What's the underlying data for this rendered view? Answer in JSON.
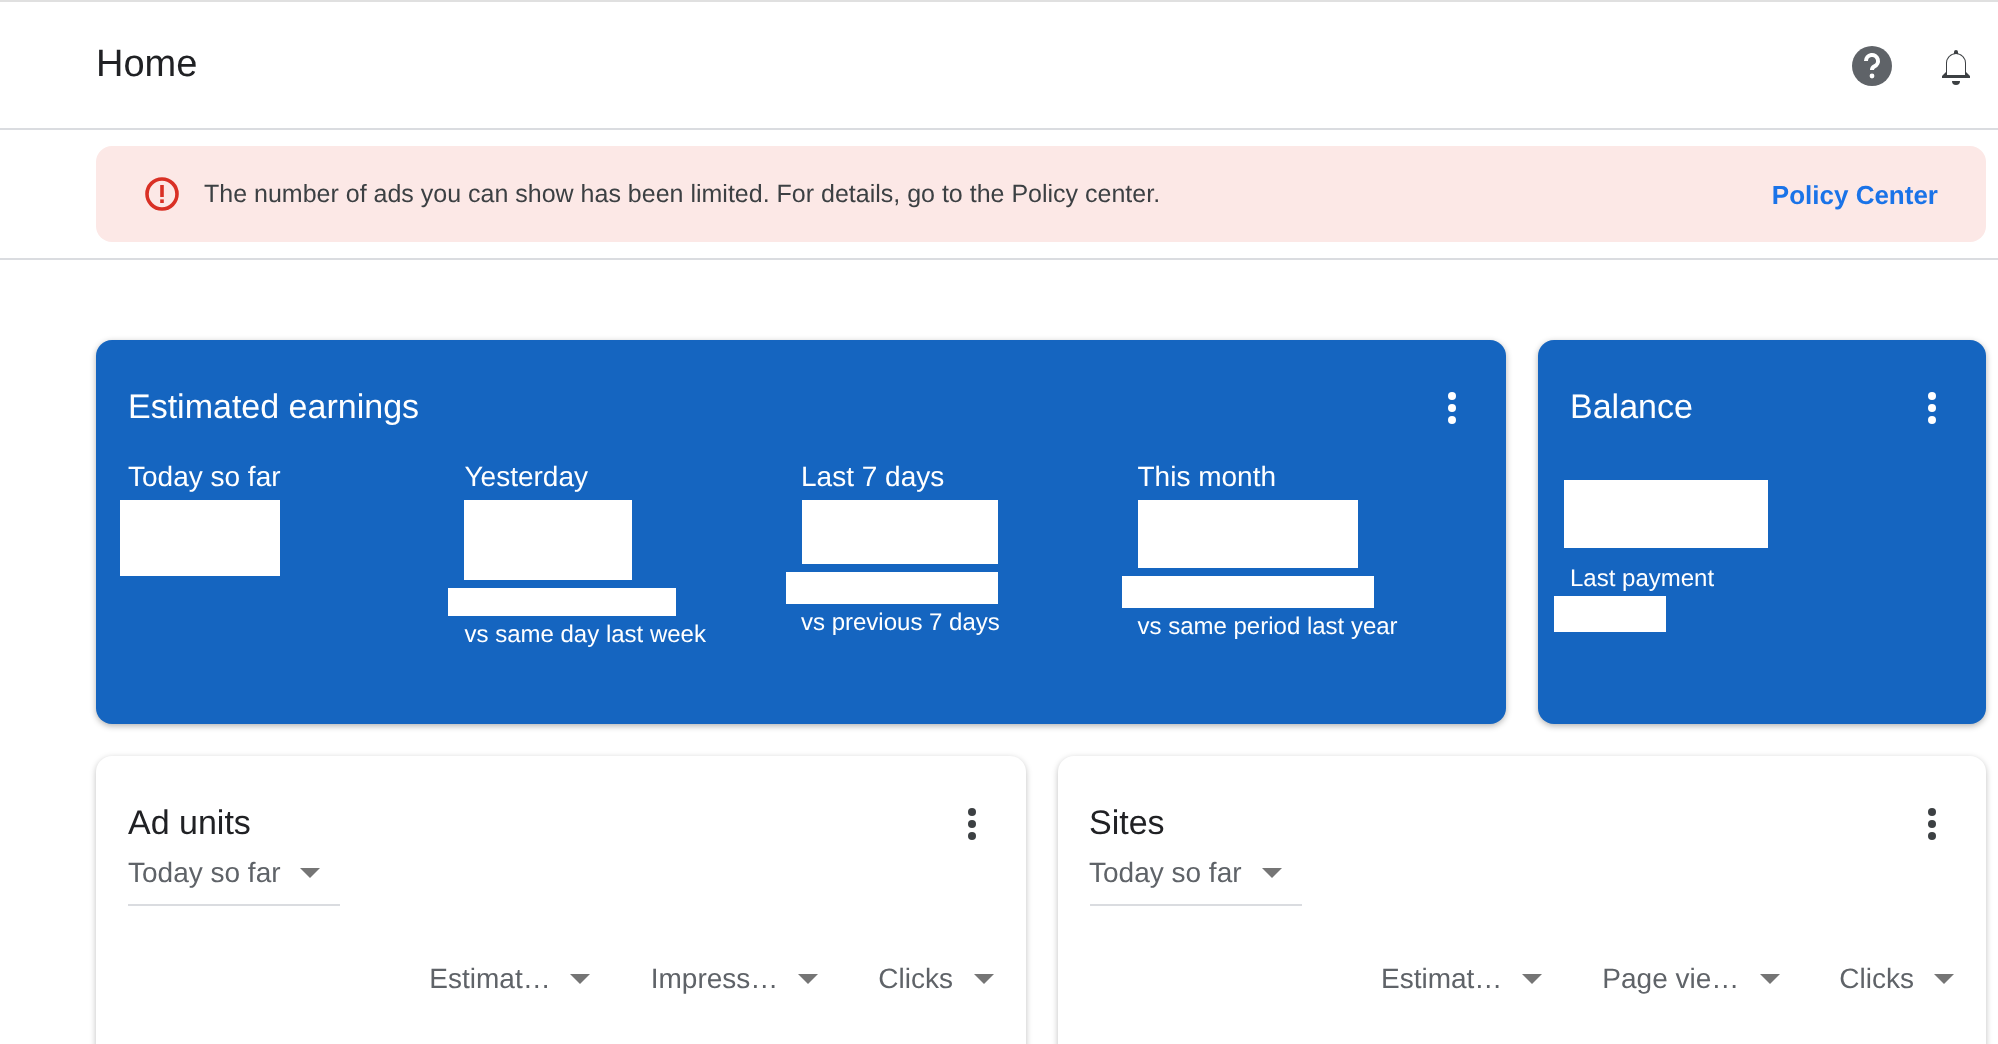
{
  "header": {
    "title": "Home"
  },
  "alert": {
    "message": "The number of ads you can show has been limited. For details, go to the Policy center.",
    "link": "Policy Center"
  },
  "earnings": {
    "title": "Estimated earnings",
    "metrics": [
      {
        "label": "Today so far"
      },
      {
        "label": "Yesterday",
        "comparison": "vs same day last week"
      },
      {
        "label": "Last 7 days",
        "comparison": "vs previous 7 days"
      },
      {
        "label": "This month",
        "comparison": "vs same period last year"
      }
    ]
  },
  "balance": {
    "title": "Balance",
    "caption": "Last payment"
  },
  "tables": [
    {
      "title": "Ad units",
      "period": "Today so far",
      "columns": [
        "Estimat…",
        "Impress…",
        "Clicks"
      ]
    },
    {
      "title": "Sites",
      "period": "Today so far",
      "columns": [
        "Estimat…",
        "Page vie…",
        "Clicks"
      ]
    }
  ]
}
